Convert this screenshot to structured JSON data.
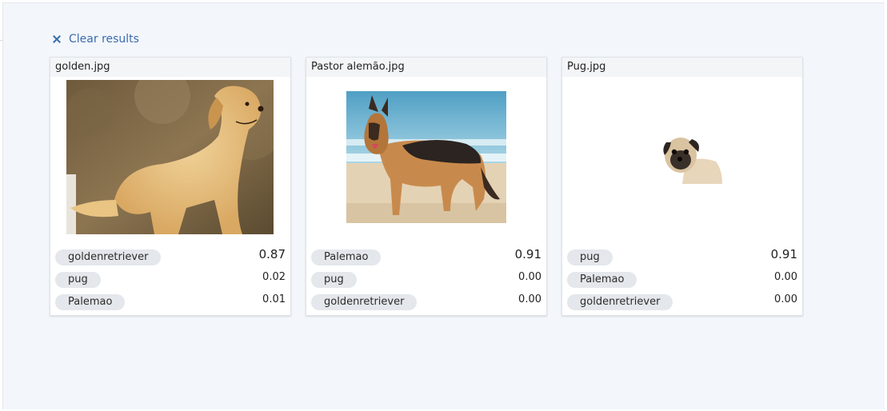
{
  "clear_results_label": "Clear results",
  "colors": {
    "link": "#3a6db0",
    "tag_bg": "#e4e7eb",
    "page_bg": "#f3f6fa"
  },
  "cards": [
    {
      "filename": "golden.jpg",
      "image": "golden-retriever-photo",
      "results": [
        {
          "label": "goldenretriever",
          "score": "0.87"
        },
        {
          "label": "pug",
          "score": "0.02"
        },
        {
          "label": "Palemao",
          "score": "0.01"
        }
      ]
    },
    {
      "filename": "Pastor alemão.jpg",
      "image": "german-shepherd-photo",
      "results": [
        {
          "label": "Palemao",
          "score": "0.91"
        },
        {
          "label": "pug",
          "score": "0.00"
        },
        {
          "label": "goldenretriever",
          "score": "0.00"
        }
      ]
    },
    {
      "filename": "Pug.jpg",
      "image": "pug-photo",
      "results": [
        {
          "label": "pug",
          "score": "0.91"
        },
        {
          "label": "Palemao",
          "score": "0.00"
        },
        {
          "label": "goldenretriever",
          "score": "0.00"
        }
      ]
    }
  ]
}
